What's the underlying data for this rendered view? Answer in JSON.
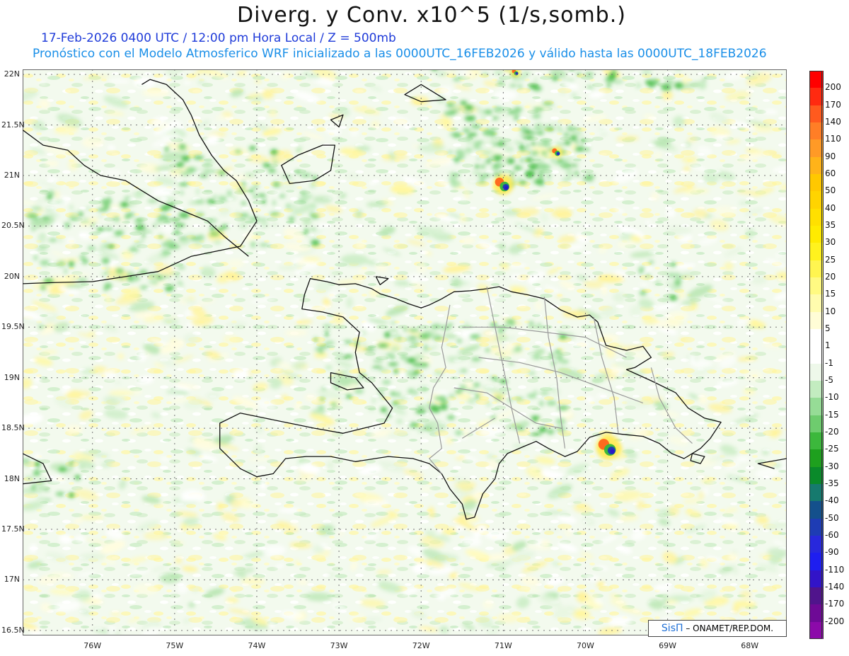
{
  "title": "Diverg. y Conv. x10^5 (1/s,somb.)",
  "subtitle_date": "17-Feb-2026  0400 UTC / 12:00 pm Hora Local / Z = 500mb",
  "subtitle_model": "Pronóstico con el Modelo Atmosferico WRF inicializado a las 0000UTC_16FEB2026 y válido hasta las  0000UTC_18FEB2026",
  "axes": {
    "lat_labels": [
      "22N",
      "21.5N",
      "21N",
      "20.5N",
      "20N",
      "19.5N",
      "19N",
      "18.5N",
      "18N",
      "17.5N",
      "17N",
      "16.5N"
    ],
    "lon_labels": [
      "76W",
      "75W",
      "74W",
      "73W",
      "72W",
      "71W",
      "70W",
      "69W",
      "68W"
    ],
    "lat_range": [
      16.45,
      22.05
    ],
    "lon_range": [
      -76.85,
      -67.55
    ],
    "grid": true
  },
  "colorbar": {
    "labels": [
      "200",
      "170",
      "140",
      "110",
      "90",
      "60",
      "50",
      "40",
      "35",
      "30",
      "25",
      "20",
      "15",
      "10",
      "5",
      "1",
      "-1",
      "-5",
      "-10",
      "-15",
      "-20",
      "-25",
      "-30",
      "-35",
      "-40",
      "-50",
      "-60",
      "-90",
      "-110",
      "-140",
      "-170",
      "-200"
    ],
    "colors": [
      "#ff0000",
      "#ff2a10",
      "#ff5a1e",
      "#ff7e26",
      "#ff9a26",
      "#ffb319",
      "#ffc800",
      "#ffd400",
      "#ffe000",
      "#ffeb00",
      "#fff21e",
      "#fff550",
      "#fffa82",
      "#fffcae",
      "#fffdd6",
      "#ffffff",
      "#ffffff",
      "#eef8ea",
      "#c3ecc0",
      "#96dc96",
      "#6ecc6e",
      "#3cb83c",
      "#1ea01e",
      "#0a8a2a",
      "#167a6e",
      "#14508c",
      "#1e3cb4",
      "#2828dc",
      "#1e1ef0",
      "#3214c8",
      "#50148c",
      "#6e0a96",
      "#8c0aaa"
    ]
  },
  "credit": {
    "system": "SisΠ",
    "org": "– ONAMET/REP.DOM."
  }
}
